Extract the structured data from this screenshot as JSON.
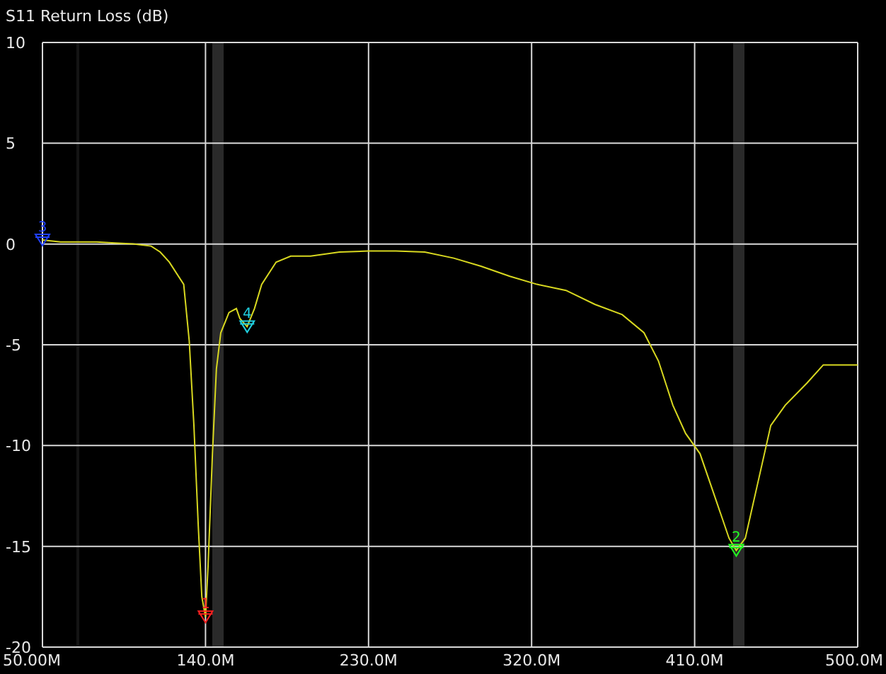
{
  "chart_data": {
    "type": "line",
    "title": "S11 Return Loss (dB)",
    "x": [
      50,
      60,
      70,
      80,
      90,
      100,
      110,
      115,
      120,
      128,
      131,
      133.6,
      136,
      138,
      140,
      141.4,
      143.8,
      146,
      148.4,
      153,
      157,
      159,
      163,
      167,
      171,
      179,
      187,
      198,
      214,
      230,
      245,
      261,
      277,
      292,
      308,
      323,
      339,
      355,
      370,
      382,
      390,
      398,
      405,
      413,
      421,
      429,
      433,
      438,
      445,
      452,
      460,
      472,
      481,
      491,
      500
    ],
    "series": [
      {
        "color": "#d8d820",
        "values": [
          0.2,
          0.1,
          0.1,
          0.1,
          0.05,
          0,
          -0.1,
          -0.4,
          -0.9,
          -2,
          -4.8,
          -9,
          -14,
          -17.5,
          -18.5,
          -16,
          -10.4,
          -6.2,
          -4.4,
          -3.4,
          -3.2,
          -3.7,
          -4.1,
          -3.2,
          -2,
          -0.9,
          -0.6,
          -0.6,
          -0.4,
          -0.35,
          -0.35,
          -0.4,
          -0.7,
          -1.1,
          -1.6,
          -2,
          -2.3,
          -3,
          -3.5,
          -4.4,
          -5.8,
          -8,
          -9.4,
          -10.4,
          -12.5,
          -14.6,
          -15.2,
          -14.6,
          -11.8,
          -9,
          -8,
          -6.9,
          -6,
          -6,
          -6
        ]
      }
    ],
    "xlim": [
      50,
      500
    ],
    "ylim": [
      -20,
      10
    ],
    "xticks": [
      {
        "value": 50,
        "label": "50.00M"
      },
      {
        "value": 140,
        "label": "140.0M"
      },
      {
        "value": 230,
        "label": "230.0M"
      },
      {
        "value": 320,
        "label": "320.0M"
      },
      {
        "value": 410,
        "label": "410.0M"
      },
      {
        "value": 500,
        "label": "500.0M"
      }
    ],
    "yticks": [
      10,
      5,
      0,
      -5,
      -10,
      -15,
      -20
    ],
    "grid": true,
    "annotations": [
      {
        "text": "1",
        "x": 140,
        "y": -18.5
      },
      {
        "text": "2",
        "x": 433,
        "y": -15.2
      },
      {
        "text": "3",
        "x": 50,
        "y": 0.2
      },
      {
        "text": "4",
        "x": 163,
        "y": -4.1
      }
    ]
  }
}
